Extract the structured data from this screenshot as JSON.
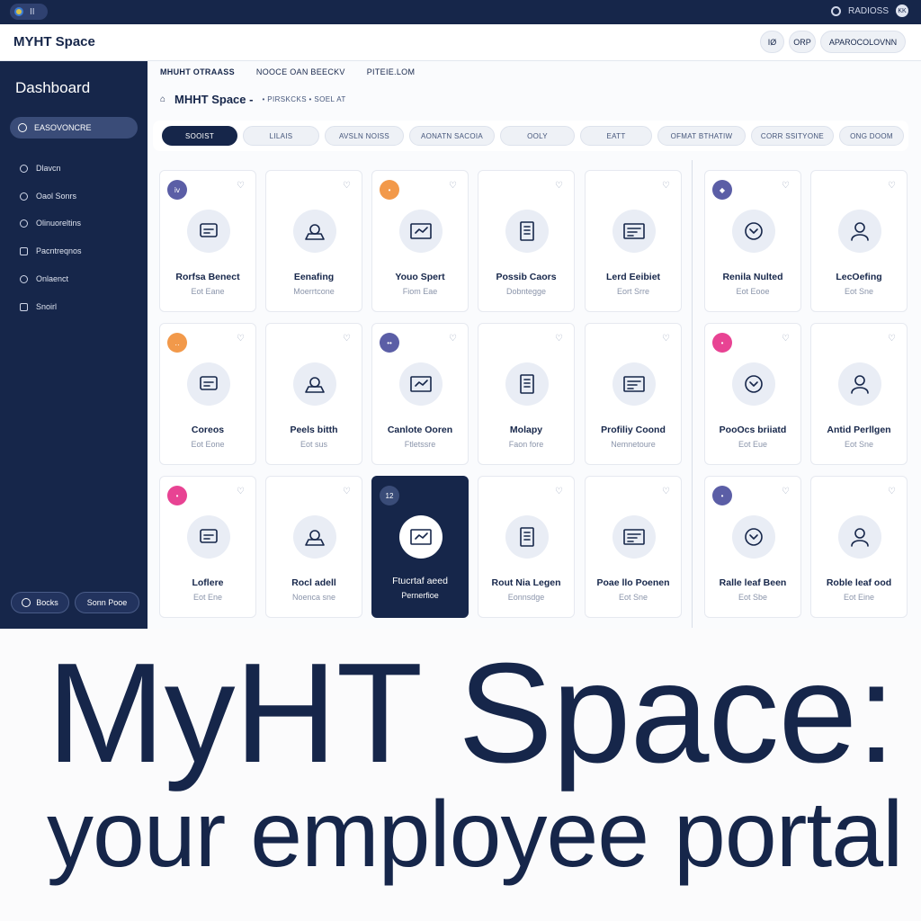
{
  "topbar": {
    "pill_text": "II",
    "user_label": "RADIOSS",
    "avatar_initials": "KK"
  },
  "header": {
    "brand": "MYHT Space",
    "btn1": "IØ",
    "btn2": "ORP",
    "btn3": "APAROCOLOVNN"
  },
  "sidebar": {
    "title": "Dashboard",
    "active_label": "EASOVONCRE",
    "items": [
      {
        "label": "Dlavcn",
        "icon": "settings-icon"
      },
      {
        "label": "Oaol Sonrs",
        "icon": "search-icon"
      },
      {
        "label": "Olinuoreltins",
        "icon": "globe-icon"
      },
      {
        "label": "Pacntreqnos",
        "icon": "document-icon"
      },
      {
        "label": "Onlaenct",
        "icon": "search-icon"
      },
      {
        "label": "Snoirl",
        "icon": "image-icon"
      }
    ],
    "bottom_left": "Bocks",
    "bottom_right": "Sonn Pooe"
  },
  "breadcrumbs": [
    "MHUHT OTRAASS",
    "NOOCE OAN BEECKV",
    "PITEIE.LOM"
  ],
  "subheader": {
    "title": "MHHT Space -",
    "links": "• PIRSKCKS • SOEL AT"
  },
  "tabs": [
    "SOOIST",
    "LILAIS",
    "AVSLN NOISS",
    "AONATN SACOIA",
    "OOLY",
    "EATT",
    "OFMAT BTHATIW",
    "CORR SSITYONE",
    "ONG DOOM"
  ],
  "cards": [
    {
      "name": "Rorfsa Benect",
      "sub": "Eot Eane",
      "badge": "ⅳ",
      "badge_color": "#5b5ea6"
    },
    {
      "name": "Eenafing",
      "sub": "Moerrtcone"
    },
    {
      "name": "Youo Spert",
      "sub": "Fiom Eae",
      "badge": "•",
      "badge_color": "#f2994a"
    },
    {
      "name": "Possib Caors",
      "sub": "Dobntegge"
    },
    {
      "name": "Lerd Eeibiet",
      "sub": "Eort Srre"
    },
    {
      "name": "Renila Nulted",
      "sub": "Eot Eooe",
      "badge": "◆",
      "badge_color": "#5b5ea6"
    },
    {
      "name": "LecOefing",
      "sub": "Eot Sne"
    },
    {
      "name": "Coreos",
      "sub": "Eot Eone",
      "badge": "‥",
      "badge_color": "#f2994a"
    },
    {
      "name": "Peels bitth",
      "sub": "Eot sus"
    },
    {
      "name": "Canlote Ooren",
      "sub": "Ftletssre",
      "badge": "••",
      "badge_color": "#5b5ea6"
    },
    {
      "name": "Molapy",
      "sub": "Faon fore"
    },
    {
      "name": "Profiliy Coond",
      "sub": "Nemnetoure"
    },
    {
      "name": "PooOcs briiatd",
      "sub": "Eot Eue",
      "badge": "•",
      "badge_color": "#e84393"
    },
    {
      "name": "Antid Perllgen",
      "sub": "Eot Sne"
    },
    {
      "name": "Loflere",
      "sub": "Eot Ene",
      "badge": "•",
      "badge_color": "#e84393"
    },
    {
      "name": "Rocl adell",
      "sub": "Noenca sne"
    },
    {
      "name": "Ftucrtaf aeed",
      "sub": "Pernerfioe",
      "badge": "12",
      "badge_color": "#3a4c78"
    },
    {
      "name": "Rout Nia Legen",
      "sub": "Eonnsdge"
    },
    {
      "name": "Poae llo Poenen",
      "sub": "Eot Sne"
    },
    {
      "name": "Ralle leaf Been",
      "sub": "Eot Sbe",
      "badge": "•",
      "badge_color": "#5b5ea6"
    },
    {
      "name": "Roble leaf ood",
      "sub": "Eot Eine"
    }
  ],
  "hero": {
    "line1": "MyHT Space:",
    "line2": "your employee portal"
  }
}
